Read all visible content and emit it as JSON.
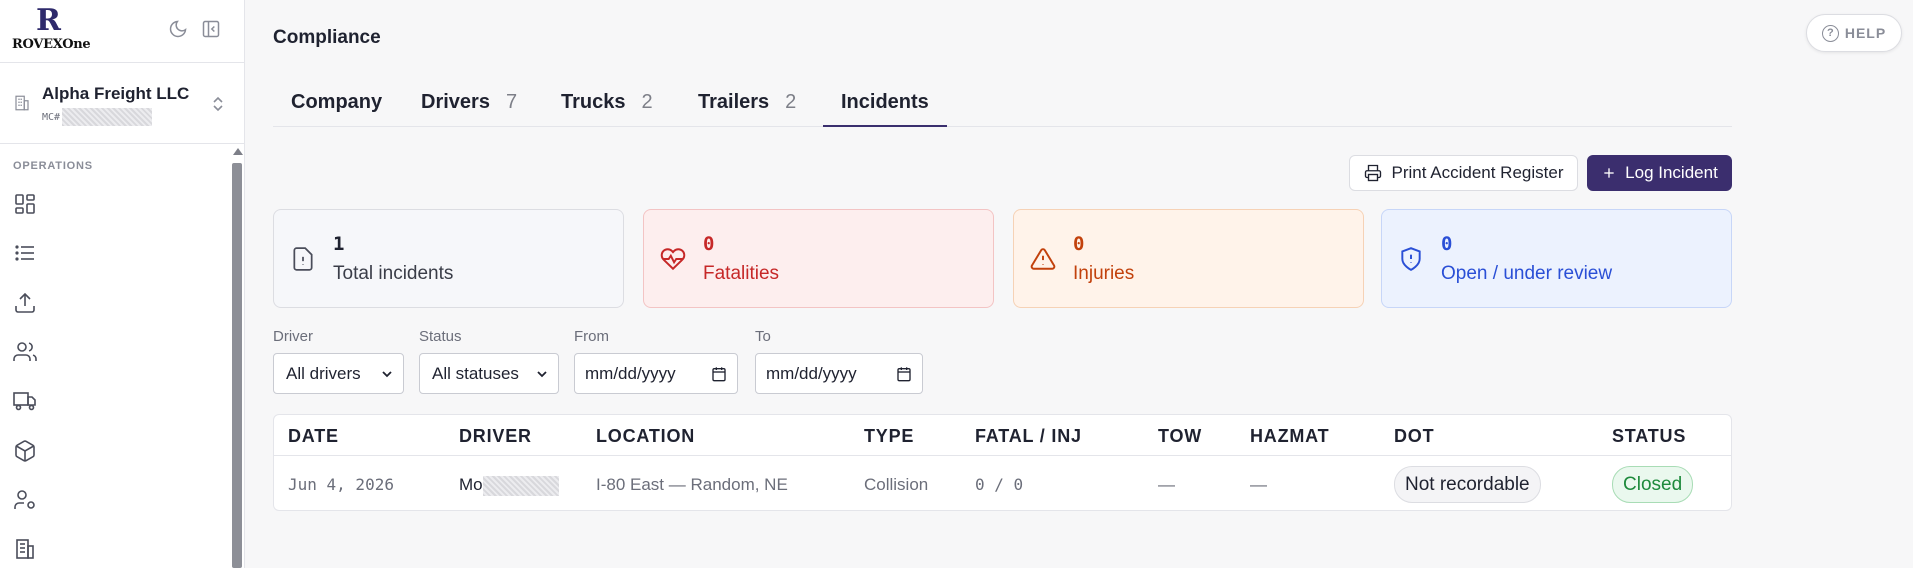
{
  "brand": {
    "letter": "R",
    "name": "ROVEXOne"
  },
  "org": {
    "name": "Alpha Freight LLC",
    "sub_prefix": "MC#"
  },
  "sidebar": {
    "section_label": "OPERATIONS"
  },
  "header": {
    "title": "Compliance",
    "help_label": "HELP"
  },
  "tabs": [
    {
      "label": "Company",
      "count": ""
    },
    {
      "label": "Drivers",
      "count": "7"
    },
    {
      "label": "Trucks",
      "count": "2"
    },
    {
      "label": "Trailers",
      "count": "2"
    },
    {
      "label": "Incidents",
      "count": ""
    }
  ],
  "actions": {
    "print_label": "Print Accident Register",
    "log_label": "Log Incident"
  },
  "stats": [
    {
      "value": "1",
      "label": "Total incidents",
      "color": "#1f2230"
    },
    {
      "value": "0",
      "label": "Fatalities",
      "color": "#c62828"
    },
    {
      "value": "0",
      "label": "Injuries",
      "color": "#c2410c"
    },
    {
      "value": "0",
      "label": "Open / under review",
      "color": "#2a4fd6"
    }
  ],
  "filters": {
    "driver": {
      "label": "Driver",
      "value": "All drivers"
    },
    "status": {
      "label": "Status",
      "value": "All statuses"
    },
    "from": {
      "label": "From",
      "value": "mm/dd/yyyy"
    },
    "to": {
      "label": "To",
      "value": "mm/dd/yyyy"
    }
  },
  "table": {
    "headers": [
      "DATE",
      "DRIVER",
      "LOCATION",
      "TYPE",
      "FATAL / INJ",
      "TOW",
      "HAZMAT",
      "DOT",
      "STATUS"
    ],
    "rows": [
      {
        "date": "Jun 4, 2026",
        "driver": "Mo",
        "location": "I-80 East — Random, NE",
        "type": "Collision",
        "fatal_inj": "0 / 0",
        "tow": "—",
        "hazmat": "—",
        "dot": "Not recordable",
        "status": "Closed"
      }
    ]
  },
  "colors": {
    "accent": "#3b2e6e",
    "success": "#1e8a3c"
  }
}
